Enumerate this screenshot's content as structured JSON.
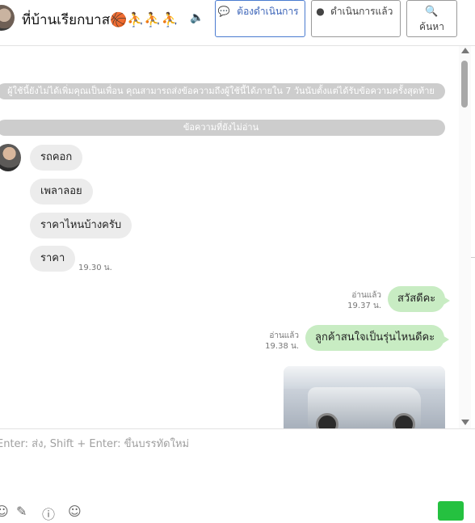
{
  "header": {
    "title": "ที่บ้านเรียกบาส🏀⛹️⛹️⛹️",
    "speaker_icon": "speaker-icon",
    "buttons": [
      {
        "icon": "chat-bubble-icon",
        "label": "ต้องดำเนินการ",
        "color": "#3a63b8",
        "active": true
      },
      {
        "icon": "chat-check-icon",
        "label": "ดำเนินการแล้ว",
        "active": false
      },
      {
        "icon": "search-icon",
        "label": "ค้นหา",
        "active": false
      }
    ]
  },
  "chat": {
    "notice_unfriend": "ผู้ใช้นี้ยังไม่ได้เพิ่มคุณเป็นเพื่อน คุณสามารถส่งข้อความถึงผู้ใช้นี้ได้ภายใน 7 วันนับตั้งแต่ได้รับข้อความครั้งสุดท้าย",
    "notice_unread": "ข้อความที่ยังไม่อ่าน",
    "incoming": [
      {
        "text": "รถคอก"
      },
      {
        "text": "เพลาลอย"
      },
      {
        "text": "ราคาไหนบ้างครับ"
      },
      {
        "text": "ราคา",
        "time": "19.30 น."
      }
    ],
    "outgoing": [
      {
        "text": "สวัสดีคะ",
        "status": "อ่านแล้ว",
        "time": "19.37 น."
      },
      {
        "text": "ลูกค้าสนใจเป็นรุ่นไหนดีคะ",
        "status": "อ่านแล้ว",
        "time": "19.38 น."
      }
    ],
    "bubble_colors": {
      "incoming": "#ececec",
      "outgoing": "#c8ecc3"
    }
  },
  "composer": {
    "placeholder": "Enter: ส่ง, Shift + Enter: ขึ้นบรรทัดใหม่",
    "tools": [
      "emoji-icon",
      "attach-icon",
      "info-icon",
      "smiley-icon"
    ],
    "send_color": "#25c140"
  }
}
